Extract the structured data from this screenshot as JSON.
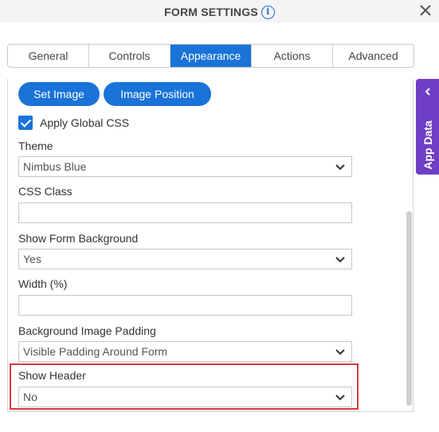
{
  "header": {
    "title": "FORM SETTINGS",
    "info_icon": "i"
  },
  "tabs": [
    {
      "label": "General",
      "active": false
    },
    {
      "label": "Controls",
      "active": false
    },
    {
      "label": "Appearance",
      "active": true
    },
    {
      "label": "Actions",
      "active": false
    },
    {
      "label": "Advanced",
      "active": false
    }
  ],
  "buttons": {
    "set_image": "Set Image",
    "image_position": "Image Position"
  },
  "apply_global_css": {
    "label": "Apply Global CSS",
    "checked": true
  },
  "fields": {
    "theme": {
      "label": "Theme",
      "value": "Nimbus Blue"
    },
    "css_class": {
      "label": "CSS Class",
      "value": ""
    },
    "show_form_background": {
      "label": "Show Form Background",
      "value": "Yes"
    },
    "width": {
      "label": "Width (%)",
      "value": ""
    },
    "background_image_padding": {
      "label": "Background Image Padding",
      "value": "Visible Padding Around Form"
    },
    "show_header": {
      "label": "Show Header",
      "value": "No"
    }
  },
  "side_panel": {
    "label": "App Data"
  },
  "colors": {
    "accent": "#1a73d9",
    "side_panel": "#6f3ec8",
    "highlight": "#d9383e"
  }
}
